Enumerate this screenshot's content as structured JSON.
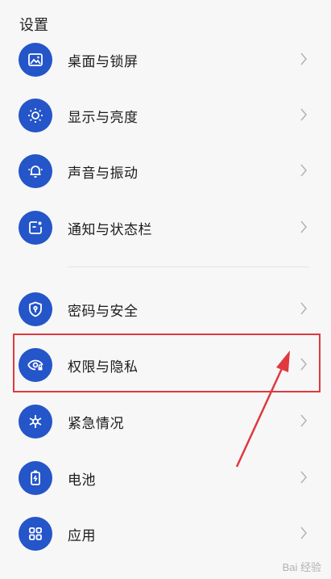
{
  "header": {
    "title": "设置"
  },
  "items": [
    {
      "label": "桌面与锁屏",
      "icon": "picture-icon"
    },
    {
      "label": "显示与亮度",
      "icon": "sun-icon"
    },
    {
      "label": "声音与振动",
      "icon": "bell-icon"
    },
    {
      "label": "通知与状态栏",
      "icon": "notification-icon"
    },
    {
      "label": "密码与安全",
      "icon": "shield-icon"
    },
    {
      "label": "权限与隐私",
      "icon": "eye-lock-icon"
    },
    {
      "label": "紧急情况",
      "icon": "asterisk-icon"
    },
    {
      "label": "电池",
      "icon": "battery-icon"
    },
    {
      "label": "应用",
      "icon": "apps-grid-icon"
    }
  ],
  "annotation": {
    "highlighted_item": "权限与隐私",
    "color": "#e0383e"
  },
  "watermark": "Bai 经验",
  "colors": {
    "accent": "#2455c9",
    "background": "#f7f7f7"
  }
}
